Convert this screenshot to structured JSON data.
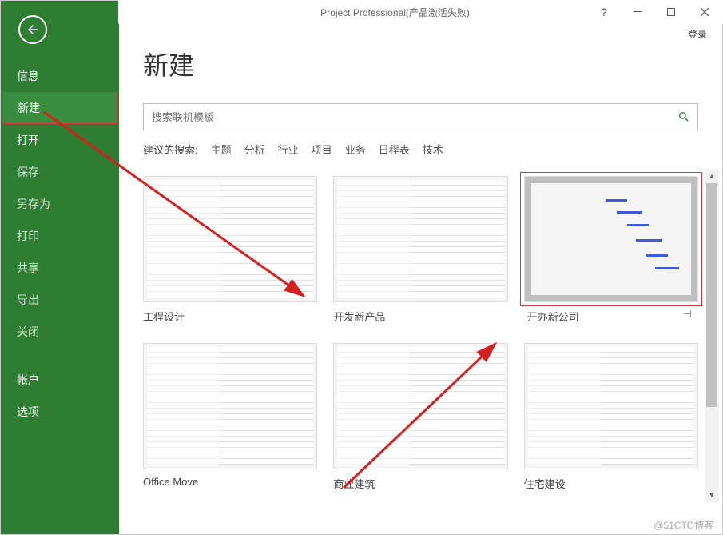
{
  "window": {
    "title": "Project Professional(产品激活失败)",
    "help": "?",
    "signin": "登录"
  },
  "sidebar": {
    "items": [
      {
        "label": "信息",
        "enabled": true,
        "active": false
      },
      {
        "label": "新建",
        "enabled": true,
        "active": true
      },
      {
        "label": "打开",
        "enabled": true,
        "active": false
      },
      {
        "label": "保存",
        "enabled": false,
        "active": false
      },
      {
        "label": "另存为",
        "enabled": false,
        "active": false
      },
      {
        "label": "打印",
        "enabled": false,
        "active": false
      },
      {
        "label": "共享",
        "enabled": false,
        "active": false
      },
      {
        "label": "导出",
        "enabled": false,
        "active": false
      },
      {
        "label": "关闭",
        "enabled": false,
        "active": false
      }
    ],
    "footer": [
      {
        "label": "帐户"
      },
      {
        "label": "选项"
      }
    ]
  },
  "main": {
    "title": "新建",
    "search": {
      "placeholder": "搜索联机模板"
    },
    "suggest": {
      "label": "建议的搜索:",
      "links": [
        "主题",
        "分析",
        "行业",
        "项目",
        "业务",
        "日程表",
        "技术"
      ]
    },
    "templates": [
      {
        "label": "工程设计",
        "selected": false
      },
      {
        "label": "开发新产品",
        "selected": false
      },
      {
        "label": "开办新公司",
        "selected": true
      },
      {
        "label": "Office Move",
        "selected": false
      },
      {
        "label": "商业建筑",
        "selected": false
      },
      {
        "label": "住宅建设",
        "selected": false
      }
    ]
  },
  "watermark": "@51CTO博客"
}
